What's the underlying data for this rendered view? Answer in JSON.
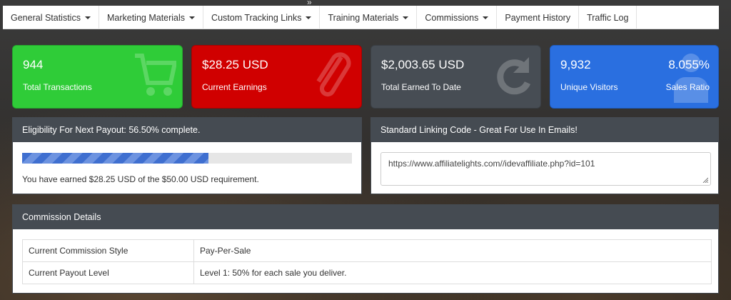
{
  "nav": [
    {
      "label": "General Statistics",
      "dropdown": true
    },
    {
      "label": "Marketing Materials",
      "dropdown": true
    },
    {
      "label": "Custom Tracking Links",
      "dropdown": true
    },
    {
      "label": "Training Materials",
      "dropdown": true
    },
    {
      "label": "Commissions",
      "dropdown": true
    },
    {
      "label": "Payment History",
      "dropdown": false
    },
    {
      "label": "Traffic Log",
      "dropdown": false
    }
  ],
  "tiles": {
    "transactions": {
      "value": "944",
      "label": "Total Transactions",
      "color": "#2fcc38",
      "icon": "cart-icon"
    },
    "earnings": {
      "value": "$28.25 USD",
      "label": "Current Earnings",
      "color": "#d00000",
      "icon": "paperclip-icon"
    },
    "earned_to_date": {
      "value": "$2,003.65 USD",
      "label": "Total Earned To Date",
      "color": "#474d54",
      "icon": "refresh-icon"
    },
    "visitors": {
      "value": "9,932",
      "label": "Unique Visitors",
      "ratio_value": "8.055%",
      "ratio_label": "Sales Ratio",
      "color": "#2a6fe0",
      "icon": "user-icon"
    }
  },
  "payout": {
    "title": "Eligibility For Next Payout: 56.50% complete.",
    "progress": 0.565,
    "message": "You have earned $28.25 USD of the $50.00 USD requirement."
  },
  "linking": {
    "title": "Standard Linking Code - Great For Use In Emails!",
    "code": "https://www.affiliatelights.com//idevaffiliate.php?id=101"
  },
  "commission": {
    "title": "Commission Details",
    "rows": [
      {
        "key": "Current Commission Style",
        "value": "Pay-Per-Sale"
      },
      {
        "key": "Current Payout Level",
        "value": "Level 1: 50% for each sale you deliver."
      }
    ]
  }
}
